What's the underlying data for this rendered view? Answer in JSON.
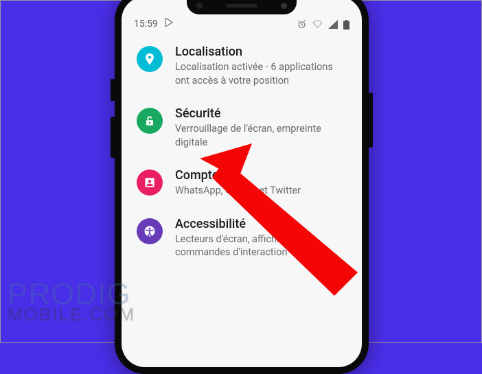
{
  "status": {
    "time": "15:59"
  },
  "settings": [
    {
      "key": "localisation",
      "title": "Localisation",
      "subtitle": "Localisation activée - 6 applications ont accès à votre position",
      "icon": "location-icon",
      "color": "#00bcd4"
    },
    {
      "key": "securite",
      "title": "Sécurité",
      "subtitle": "Verrouillage de l'écran, empreinte digitale",
      "icon": "lock-open-icon",
      "color": "#18a85f"
    },
    {
      "key": "comptes",
      "title": "Comptes",
      "subtitle": "WhatsApp, Google et Twitter",
      "icon": "account-box-icon",
      "color": "#e91e63"
    },
    {
      "key": "accessibilite",
      "title": "Accessibilité",
      "subtitle": "Lecteurs d'écran, affichage, commandes d'interaction",
      "icon": "accessibility-icon",
      "color": "#673ab7"
    }
  ],
  "watermark": {
    "line1": "PRODIG",
    "line2": "MOBILE.COM"
  }
}
